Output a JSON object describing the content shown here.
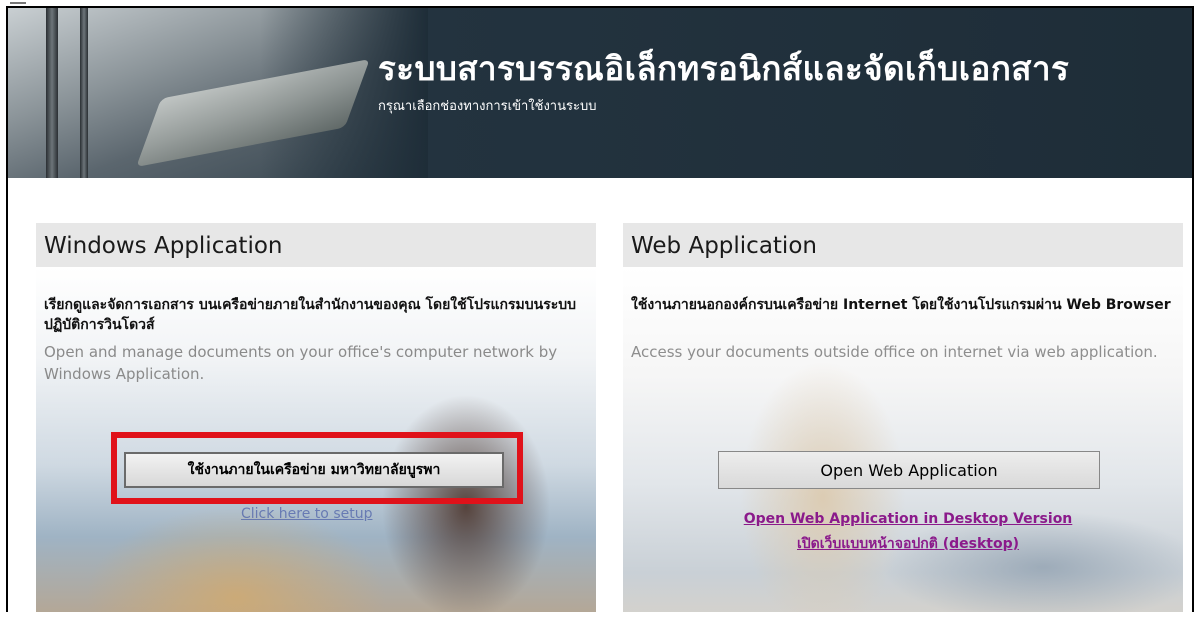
{
  "header": {
    "title": "ระบบสารบรรณอิเล็กทรอนิกส์และจัดเก็บเอกสาร",
    "subtitle": "กรุณาเลือกช่องทางการเข้าใช้งานระบบ"
  },
  "windows_panel": {
    "heading": "Windows Application",
    "description_th": "เรียกดูและจัดการเอกสาร บนเครือข่ายภายในสำนักงานของคุณ โดยใช้โปรแกรมบนระบบปฏิบัติการวินโดวส์",
    "description_en": "Open and manage documents on your office's computer network by Windows Application.",
    "button_label": "ใช้งานภายในเครือข่าย มหาวิทยาลัยบูรพา",
    "setup_link": "Click here to setup"
  },
  "web_panel": {
    "heading": "Web Application",
    "description_th": "ใช้งานภายนอกองค์กรบนเครือข่าย Internet โดยใช้งานโปรแกรมผ่าน Web Browser",
    "description_en": "Access your documents outside office on internet via web application.",
    "button_label": "Open Web Application",
    "desktop_link_en": "Open Web Application in Desktop Version",
    "desktop_link_th": "เปิดเว็บแบบหน้าจอปกติ (desktop)"
  },
  "colors": {
    "header_bg": "#1e2d38",
    "highlight_red": "#e0121a",
    "link_purple": "#8b1a8b"
  }
}
